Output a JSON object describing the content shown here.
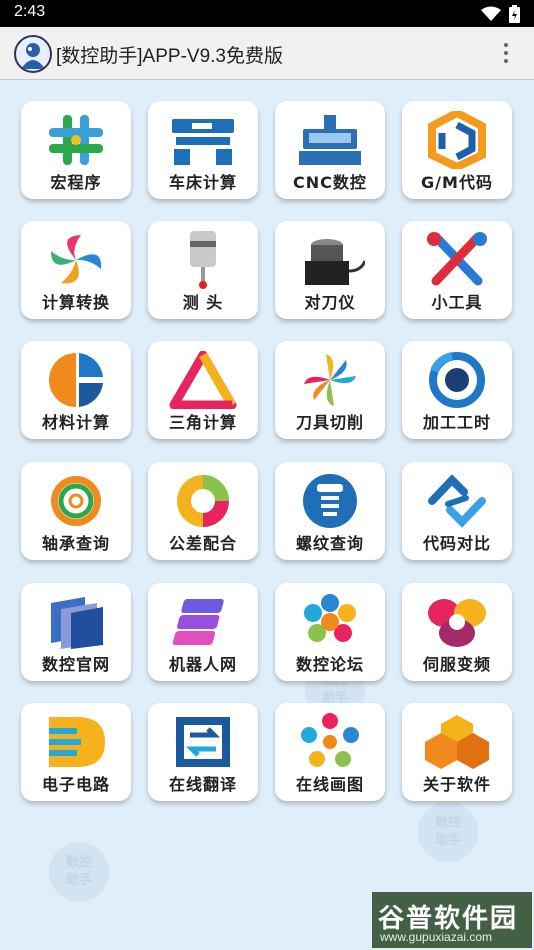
{
  "status": {
    "time": "2:43"
  },
  "app": {
    "title": "[数控助手]APP-V9.3免费版"
  },
  "tiles": [
    {
      "label": "宏程序",
      "icon": "hash-icon"
    },
    {
      "label": "车床计算",
      "icon": "lathe-icon"
    },
    {
      "label": "CNC数控",
      "icon": "cnc-machine-icon"
    },
    {
      "label": "G/M代码",
      "icon": "gm-code-icon"
    },
    {
      "label": "计算转换",
      "icon": "swirl-icon"
    },
    {
      "label": "测 头",
      "icon": "probe-icon"
    },
    {
      "label": "对刀仪",
      "icon": "tool-setter-icon"
    },
    {
      "label": "小工具",
      "icon": "tools-icon"
    },
    {
      "label": "材料计算",
      "icon": "pie-icon"
    },
    {
      "label": "三角计算",
      "icon": "triangle-icon"
    },
    {
      "label": "刀具切削",
      "icon": "pinwheel-icon"
    },
    {
      "label": "加工工时",
      "icon": "clock-ring-icon"
    },
    {
      "label": "轴承查询",
      "icon": "bearing-icon"
    },
    {
      "label": "公差配合",
      "icon": "tolerance-icon"
    },
    {
      "label": "螺纹查询",
      "icon": "screw-icon"
    },
    {
      "label": "代码对比",
      "icon": "link-icon"
    },
    {
      "label": "数控官网",
      "icon": "cube-icon"
    },
    {
      "label": "机器人网",
      "icon": "layers-icon"
    },
    {
      "label": "数控论坛",
      "icon": "flower-icon"
    },
    {
      "label": "伺服变频",
      "icon": "servo-icon"
    },
    {
      "label": "电子电路",
      "icon": "circuit-d-icon"
    },
    {
      "label": "在线翻译",
      "icon": "translate-icon"
    },
    {
      "label": "在线画图",
      "icon": "drawing-icon"
    },
    {
      "label": "关于软件",
      "icon": "hex-cubes-icon"
    }
  ],
  "watermarks": [
    "数控\n助手",
    "数控\n助手",
    "数控\n助手"
  ],
  "brand": {
    "name": "谷普软件园",
    "url": "www.gupuxiazai.com"
  }
}
